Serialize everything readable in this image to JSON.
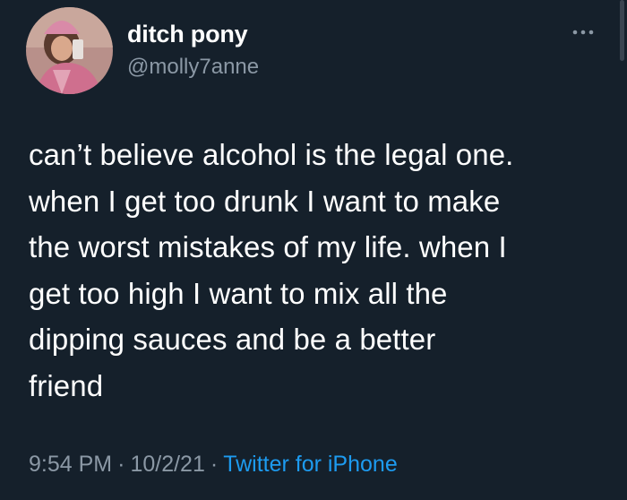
{
  "author": {
    "display_name": "ditch pony",
    "handle": "@molly7anne"
  },
  "tweet": {
    "text": "can’t believe alcohol is the legal one.\nwhen I get too drunk I want to make\nthe worst mistakes of my life. when I\nget too high I want to mix all the\ndipping sauces and be a better\nfriend",
    "time": "9:54 PM",
    "separator": "·",
    "date": "10/2/21",
    "source": "Twitter for iPhone"
  },
  "icons": {
    "avatar": "avatar-photo",
    "more": "more-dots-icon"
  },
  "colors": {
    "background": "#15202b",
    "primary_text": "#ffffff",
    "secondary_text": "#8b98a5",
    "link": "#1d9bf0"
  }
}
